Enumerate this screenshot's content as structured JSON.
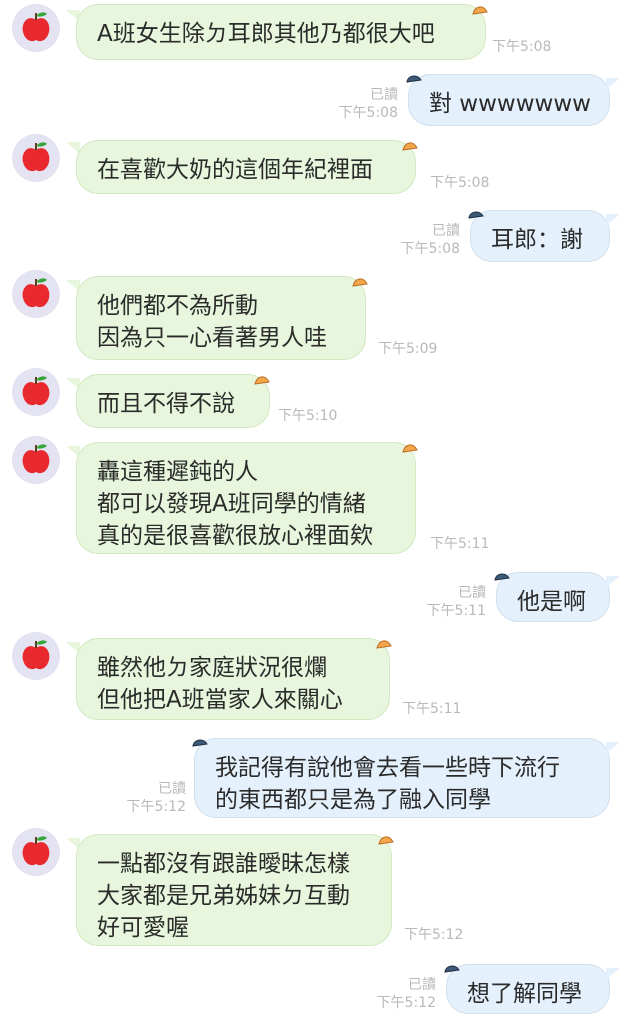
{
  "chat": {
    "messages": [
      {
        "dir": "in",
        "lines": [
          "A班女生除ㄉ耳郎其他乃都很大吧"
        ],
        "time": "下午5:08"
      },
      {
        "dir": "out",
        "lines": [
          "對 wwwwwww"
        ],
        "read": "已讀",
        "time": "下午5:08"
      },
      {
        "dir": "in",
        "lines": [
          "在喜歡大奶的這個年紀裡面"
        ],
        "time": "下午5:08"
      },
      {
        "dir": "out",
        "lines": [
          "耳郎：謝"
        ],
        "read": "已讀",
        "time": "下午5:08"
      },
      {
        "dir": "in",
        "lines": [
          "他們都不為所動",
          "因為只一心看著男人哇"
        ],
        "time": "下午5:09"
      },
      {
        "dir": "in",
        "lines": [
          "而且不得不說"
        ],
        "time": "下午5:10"
      },
      {
        "dir": "in",
        "lines": [
          "轟這種遲鈍的人",
          "都可以發現A班同學的情緒",
          "真的是很喜歡很放心裡面欸"
        ],
        "time": "下午5:11"
      },
      {
        "dir": "out",
        "lines": [
          "他是啊"
        ],
        "read": "已讀",
        "time": "下午5:11"
      },
      {
        "dir": "in",
        "lines": [
          "雖然他ㄉ家庭狀況很爛",
          "但他把A班當家人來關心"
        ],
        "time": "下午5:11"
      },
      {
        "dir": "out",
        "lines": [
          "我記得有說他會去看一些時下流行",
          "的東西都只是為了融入同學"
        ],
        "read": "已讀",
        "time": "下午5:12"
      },
      {
        "dir": "in",
        "lines": [
          "一點都沒有跟誰曖昧怎樣",
          "大家都是兄弟姊妹ㄉ互動",
          "好可愛喔"
        ],
        "time": "下午5:12"
      },
      {
        "dir": "out",
        "lines": [
          "想了解同學"
        ],
        "read": "已讀",
        "time": "下午5:12"
      }
    ]
  },
  "colors": {
    "incoming_bubble": "#e7f6dc",
    "outgoing_bubble": "#e4f0fb",
    "meta_text": "#b9b9b9",
    "avatar_bg": "#e3e3f1"
  },
  "icons": {
    "avatar": "red-apple-icon",
    "incoming_bubble_decoration": "orange-hat-icon",
    "outgoing_bubble_decoration": "blue-cap-icon"
  }
}
